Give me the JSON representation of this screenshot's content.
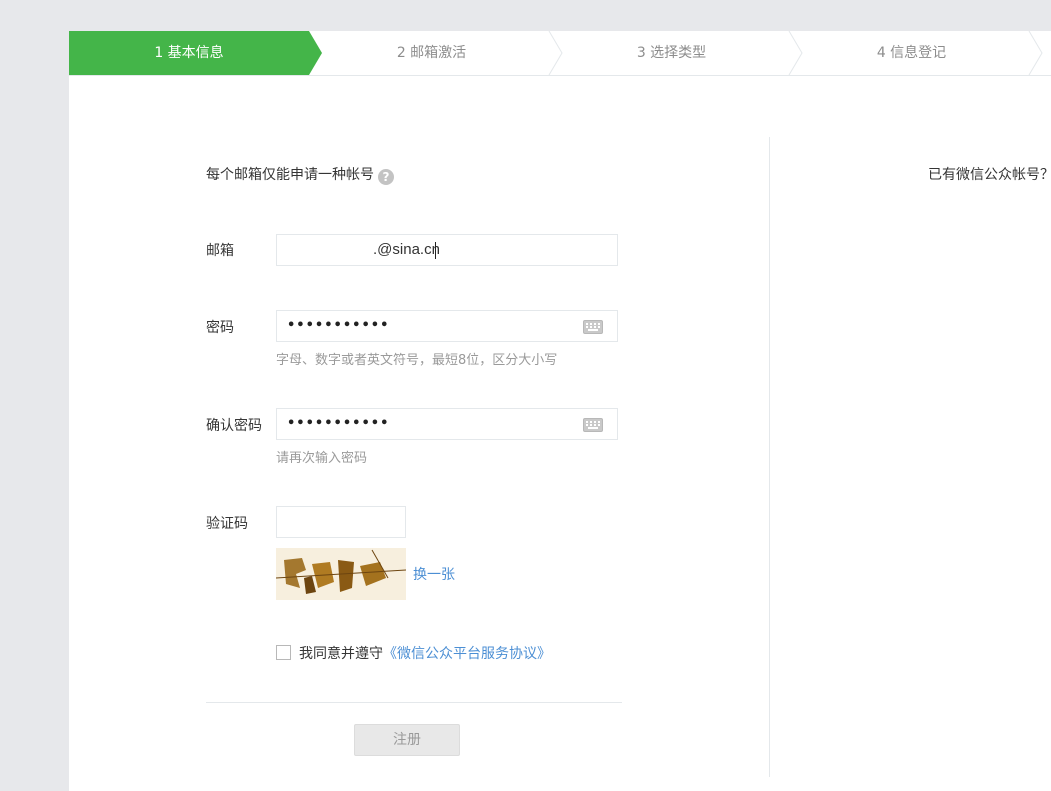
{
  "steps": [
    {
      "label": "1 基本信息",
      "active": true
    },
    {
      "label": "2 邮箱激活",
      "active": false
    },
    {
      "label": "3 选择类型",
      "active": false
    },
    {
      "label": "4 信息登记",
      "active": false
    }
  ],
  "colors": {
    "accent": "#44b549",
    "link": "#4c8fd4",
    "page_bg": "#e7e8eb",
    "border": "#e4e8eb"
  },
  "form": {
    "notice": "每个邮箱仅能申请一种帐号",
    "help_icon": "?",
    "email": {
      "label": "邮箱",
      "value": ".@sina.cn"
    },
    "password": {
      "label": "密码",
      "value": "•••••••••••",
      "hint": "字母、数字或者英文符号，最短8位，区分大小写"
    },
    "confirm_password": {
      "label": "确认密码",
      "value": "•••••••••••",
      "hint": "请再次输入密码"
    },
    "captcha": {
      "label": "验证码",
      "value": "",
      "refresh_label": "换一张"
    },
    "agreement": {
      "prefix": "我同意并遵守",
      "link_text": "《微信公众平台服务协议》",
      "checked": false
    },
    "submit_label": "注册"
  },
  "side": {
    "existing_account": "已有微信公众帐号？"
  },
  "icons": [
    "help-icon",
    "keyboard-icon",
    "captcha-image",
    "checkbox"
  ]
}
